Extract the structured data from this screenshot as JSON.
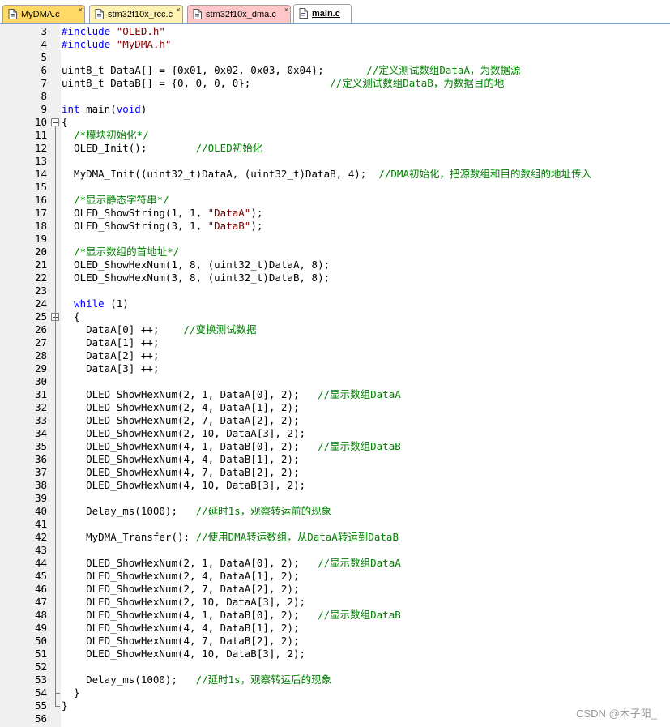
{
  "tabs": [
    {
      "label": "MyDMA.c",
      "color": "#ffd966",
      "active": false,
      "name": "tab-mydma-c"
    },
    {
      "label": "stm32f10x_rcc.c",
      "color": "#fff2b3",
      "active": false,
      "name": "tab-stm32f10x-rcc-c"
    },
    {
      "label": "stm32f10x_dma.c",
      "color": "#ffc7c7",
      "active": false,
      "name": "tab-stm32f10x-dma-c"
    },
    {
      "label": "main.c",
      "color": "#ffffff",
      "active": true,
      "name": "tab-main-c"
    }
  ],
  "lines": [
    {
      "n": "3",
      "segs": [
        [
          "#include ",
          "pre"
        ],
        [
          "\"OLED.h\"",
          "str"
        ]
      ]
    },
    {
      "n": "4",
      "segs": [
        [
          "#include ",
          "pre"
        ],
        [
          "\"MyDMA.h\"",
          "str"
        ]
      ]
    },
    {
      "n": "5",
      "segs": []
    },
    {
      "n": "6",
      "segs": [
        [
          "uint8_t DataA[] = {0x01, 0x02, 0x03, 0x04};       ",
          ""
        ],
        [
          "//定义测试数组DataA，为数据源",
          "cmt"
        ]
      ]
    },
    {
      "n": "7",
      "segs": [
        [
          "uint8_t DataB[] = {0, 0, 0, 0};             ",
          ""
        ],
        [
          "//定义测试数组DataB，为数据目的地",
          "cmt"
        ]
      ]
    },
    {
      "n": "8",
      "segs": []
    },
    {
      "n": "9",
      "segs": [
        [
          "int",
          "kw"
        ],
        [
          " main(",
          ""
        ],
        [
          "void",
          "kw"
        ],
        [
          ")",
          ""
        ]
      ]
    },
    {
      "n": "10",
      "segs": [
        [
          "{",
          ""
        ]
      ],
      "fold": "open"
    },
    {
      "n": "11",
      "segs": [
        [
          "  ",
          ""
        ],
        [
          "/*模块初始化*/",
          "cmt"
        ]
      ]
    },
    {
      "n": "12",
      "segs": [
        [
          "  OLED_Init();        ",
          ""
        ],
        [
          "//OLED初始化",
          "cmt"
        ]
      ]
    },
    {
      "n": "13",
      "segs": []
    },
    {
      "n": "14",
      "segs": [
        [
          "  MyDMA_Init((uint32_t)DataA, (uint32_t)DataB, 4);  ",
          ""
        ],
        [
          "//DMA初始化，把源数组和目的数组的地址传入",
          "cmt"
        ]
      ]
    },
    {
      "n": "15",
      "segs": []
    },
    {
      "n": "16",
      "segs": [
        [
          "  ",
          ""
        ],
        [
          "/*显示静态字符串*/",
          "cmt"
        ]
      ]
    },
    {
      "n": "17",
      "segs": [
        [
          "  OLED_ShowString(1, 1, ",
          ""
        ],
        [
          "\"DataA\"",
          "str"
        ],
        [
          ");",
          ""
        ]
      ]
    },
    {
      "n": "18",
      "segs": [
        [
          "  OLED_ShowString(3, 1, ",
          ""
        ],
        [
          "\"DataB\"",
          "str"
        ],
        [
          ");",
          ""
        ]
      ]
    },
    {
      "n": "19",
      "segs": []
    },
    {
      "n": "20",
      "segs": [
        [
          "  ",
          ""
        ],
        [
          "/*显示数组的首地址*/",
          "cmt"
        ]
      ]
    },
    {
      "n": "21",
      "segs": [
        [
          "  OLED_ShowHexNum(1, 8, (uint32_t)DataA, 8);",
          ""
        ]
      ]
    },
    {
      "n": "22",
      "segs": [
        [
          "  OLED_ShowHexNum(3, 8, (uint32_t)DataB, 8);",
          ""
        ]
      ]
    },
    {
      "n": "23",
      "segs": []
    },
    {
      "n": "24",
      "segs": [
        [
          "  ",
          ""
        ],
        [
          "while",
          "kw"
        ],
        [
          " (1)",
          ""
        ]
      ]
    },
    {
      "n": "25",
      "segs": [
        [
          "  {",
          ""
        ]
      ],
      "fold": "open"
    },
    {
      "n": "26",
      "segs": [
        [
          "    DataA[0] ++;    ",
          ""
        ],
        [
          "//变换测试数据",
          "cmt"
        ]
      ]
    },
    {
      "n": "27",
      "segs": [
        [
          "    DataA[1] ++;",
          ""
        ]
      ]
    },
    {
      "n": "28",
      "segs": [
        [
          "    DataA[2] ++;",
          ""
        ]
      ]
    },
    {
      "n": "29",
      "segs": [
        [
          "    DataA[3] ++;",
          ""
        ]
      ]
    },
    {
      "n": "30",
      "segs": []
    },
    {
      "n": "31",
      "segs": [
        [
          "    OLED_ShowHexNum(2, 1, DataA[0], 2);   ",
          ""
        ],
        [
          "//显示数组DataA",
          "cmt"
        ]
      ]
    },
    {
      "n": "32",
      "segs": [
        [
          "    OLED_ShowHexNum(2, 4, DataA[1], 2);",
          ""
        ]
      ]
    },
    {
      "n": "33",
      "segs": [
        [
          "    OLED_ShowHexNum(2, 7, DataA[2], 2);",
          ""
        ]
      ]
    },
    {
      "n": "34",
      "segs": [
        [
          "    OLED_ShowHexNum(2, 10, DataA[3], 2);",
          ""
        ]
      ]
    },
    {
      "n": "35",
      "segs": [
        [
          "    OLED_ShowHexNum(4, 1, DataB[0], 2);   ",
          ""
        ],
        [
          "//显示数组DataB",
          "cmt"
        ]
      ]
    },
    {
      "n": "36",
      "segs": [
        [
          "    OLED_ShowHexNum(4, 4, DataB[1], 2);",
          ""
        ]
      ]
    },
    {
      "n": "37",
      "segs": [
        [
          "    OLED_ShowHexNum(4, 7, DataB[2], 2);",
          ""
        ]
      ]
    },
    {
      "n": "38",
      "segs": [
        [
          "    OLED_ShowHexNum(4, 10, DataB[3], 2);",
          ""
        ]
      ]
    },
    {
      "n": "39",
      "segs": []
    },
    {
      "n": "40",
      "segs": [
        [
          "    Delay_ms(1000);   ",
          ""
        ],
        [
          "//延时1s，观察转运前的现象",
          "cmt"
        ]
      ]
    },
    {
      "n": "41",
      "segs": []
    },
    {
      "n": "42",
      "segs": [
        [
          "    MyDMA_Transfer(); ",
          ""
        ],
        [
          "//使用DMA转运数组，从DataA转运到DataB",
          "cmt"
        ]
      ]
    },
    {
      "n": "43",
      "segs": []
    },
    {
      "n": "44",
      "segs": [
        [
          "    OLED_ShowHexNum(2, 1, DataA[0], 2);   ",
          ""
        ],
        [
          "//显示数组DataA",
          "cmt"
        ]
      ]
    },
    {
      "n": "45",
      "segs": [
        [
          "    OLED_ShowHexNum(2, 4, DataA[1], 2);",
          ""
        ]
      ]
    },
    {
      "n": "46",
      "segs": [
        [
          "    OLED_ShowHexNum(2, 7, DataA[2], 2);",
          ""
        ]
      ]
    },
    {
      "n": "47",
      "segs": [
        [
          "    OLED_ShowHexNum(2, 10, DataA[3], 2);",
          ""
        ]
      ]
    },
    {
      "n": "48",
      "segs": [
        [
          "    OLED_ShowHexNum(4, 1, DataB[0], 2);   ",
          ""
        ],
        [
          "//显示数组DataB",
          "cmt"
        ]
      ]
    },
    {
      "n": "49",
      "segs": [
        [
          "    OLED_ShowHexNum(4, 4, DataB[1], 2);",
          ""
        ]
      ]
    },
    {
      "n": "50",
      "segs": [
        [
          "    OLED_ShowHexNum(4, 7, DataB[2], 2);",
          ""
        ]
      ]
    },
    {
      "n": "51",
      "segs": [
        [
          "    OLED_ShowHexNum(4, 10, DataB[3], 2);",
          ""
        ]
      ]
    },
    {
      "n": "52",
      "segs": []
    },
    {
      "n": "53",
      "segs": [
        [
          "    Delay_ms(1000);   ",
          ""
        ],
        [
          "//延时1s，观察转运后的现象",
          "cmt"
        ]
      ]
    },
    {
      "n": "54",
      "segs": [
        [
          "  }",
          ""
        ]
      ],
      "fold": "end"
    },
    {
      "n": "55",
      "segs": [
        [
          "}",
          ""
        ]
      ],
      "fold": "end"
    },
    {
      "n": "56",
      "segs": []
    }
  ],
  "watermark": "CSDN @木子阳_"
}
